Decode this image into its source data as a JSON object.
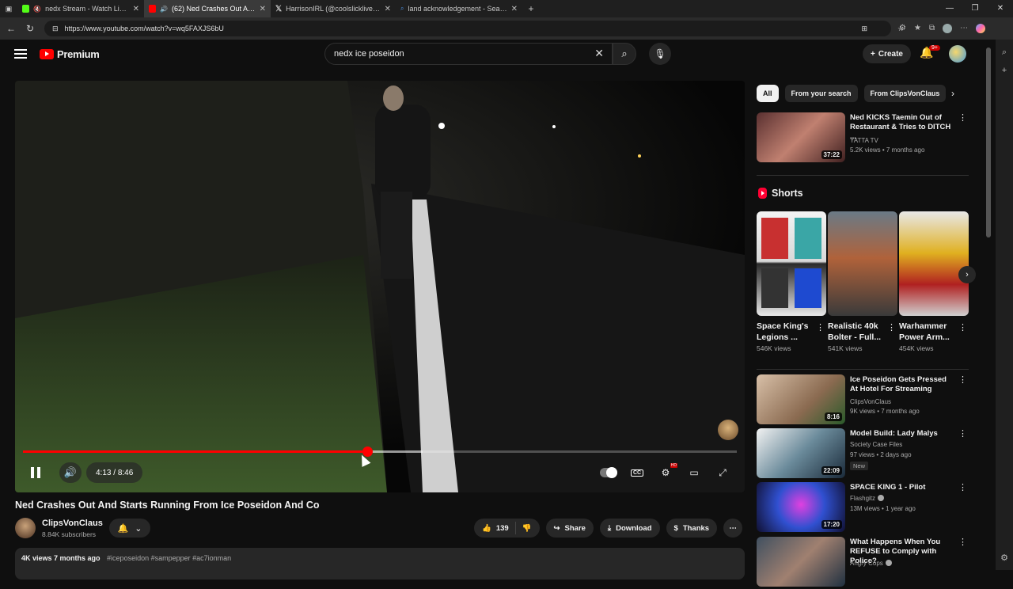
{
  "browser": {
    "tabs": [
      {
        "title": "nedx Stream - Watch Live on",
        "icon_color": "#53fc18",
        "active": false
      },
      {
        "title": "(62) Ned Crashes Out And St",
        "icon_color": "#ff0000",
        "active": true
      },
      {
        "title": "HarrisonIRL (@coolslicklive) / X",
        "icon_color": "#ffffff",
        "active": false
      },
      {
        "title": "land acknowledgement - Search",
        "icon_color": "#4a90e2",
        "active": false
      }
    ],
    "new_tab": "+",
    "url": "https://www.youtube.com/watch?v=wq5FAXJS6bU"
  },
  "youtube": {
    "logo": "Premium",
    "search": {
      "query": "nedx ice poseidon"
    },
    "create_label": "Create",
    "notification_count": "9+"
  },
  "player": {
    "current_time": "4:13",
    "duration": "8:46",
    "played_fraction": 0.482,
    "buffered_fraction": 0.56
  },
  "video": {
    "title": "Ned Crashes Out And Starts Running From Ice Poseidon And Co",
    "channel": "ClipsVonClaus",
    "subscribers": "8.84K subscribers",
    "likes": "139",
    "share_label": "Share",
    "download_label": "Download",
    "thanks_label": "Thanks",
    "views_date": "4K views  7 months ago",
    "hashtags": "#iceposeidon #sampepper #ac7ionman"
  },
  "sidebar": {
    "chips": [
      "All",
      "From your search",
      "From ClipsVonClaus"
    ],
    "first_video": {
      "title": "Ned KICKS Taemin Out of Restaurant & Tries to DITCH ...",
      "channel": "YATTA TV",
      "meta": "5.2K views • 7 months ago",
      "duration": "37:22"
    },
    "shorts_title": "Shorts",
    "shorts": [
      {
        "title": "Space King's Legions ...",
        "views": "546K views"
      },
      {
        "title": "Realistic 40k Bolter - Full...",
        "views": "541K views"
      },
      {
        "title": "Warhammer Power Arm...",
        "views": "454K views"
      }
    ],
    "videos": [
      {
        "title": "Ice Poseidon Gets Pressed At Hotel For Streaming",
        "channel": "ClipsVonClaus",
        "meta": "9K views • 7 months ago",
        "duration": "8:16"
      },
      {
        "title": "Model Build: Lady Malys",
        "channel": "Society Case Files",
        "meta": "97 views • 2 days ago",
        "duration": "22:09",
        "badge": "New"
      },
      {
        "title": "SPACE KING 1 - Pilot",
        "channel": "Flashgitz",
        "meta": "13M views • 1 year ago",
        "duration": "17:20"
      },
      {
        "title": "What Happens When You REFUSE to Comply with Police?",
        "channel": "Angry Cops",
        "meta": "",
        "duration": ""
      }
    ]
  }
}
